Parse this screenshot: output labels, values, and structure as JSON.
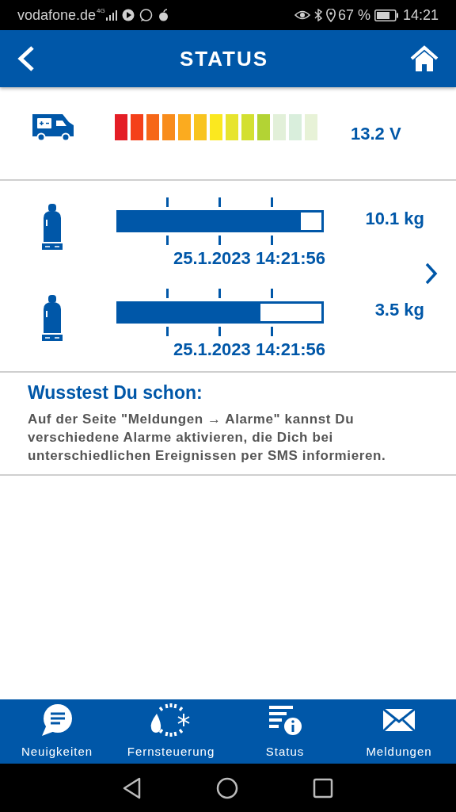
{
  "status_bar": {
    "carrier": "vodafone.de",
    "network": "4G",
    "battery": "67 %",
    "time": "14:21"
  },
  "header": {
    "title": "STATUS"
  },
  "battery": {
    "level": 0.77,
    "reading": "13.2 V"
  },
  "gas": [
    {
      "level": 0.9,
      "reading": "10.1 kg",
      "timestamp": "25.1.2023 14:21:56"
    },
    {
      "level": 0.7,
      "reading": "3.5 kg",
      "timestamp": "25.1.2023 14:21:56"
    }
  ],
  "tip": {
    "title": "Wusstest Du schon:",
    "text": "Auf der Seite \"Meldungen → Alarme\" kannst Du verschiedene Alarme aktivieren, die Dich bei unterschiedlichen Ereignissen per SMS informieren."
  },
  "nav": [
    {
      "kind": "news",
      "label": "Neuigkeiten"
    },
    {
      "kind": "remote",
      "label": "Fernsteuerung"
    },
    {
      "kind": "status",
      "label": "Status"
    },
    {
      "kind": "messages",
      "label": "Meldungen"
    }
  ]
}
